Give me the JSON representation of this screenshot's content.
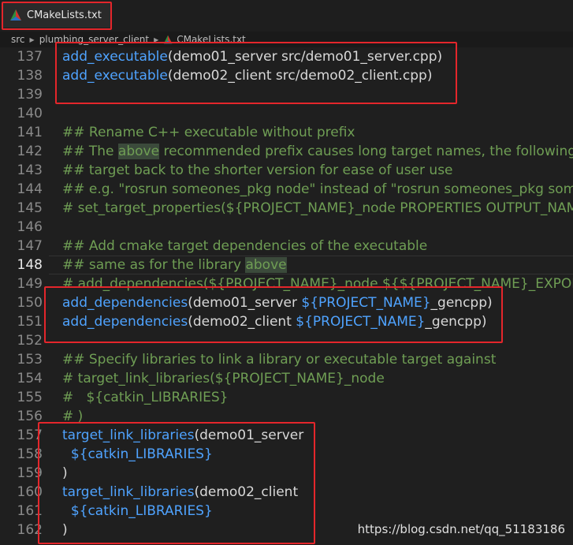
{
  "tab": {
    "label": "CMakeLists.txt"
  },
  "breadcrumb": [
    "src",
    "plumbing_server_client",
    "CMakeLists.txt"
  ],
  "current_line": "148",
  "lines": [
    {
      "no": "137",
      "parts": [
        {
          "c": "fn",
          "t": "add_executable"
        },
        {
          "c": "",
          "t": "(demo01_server src/demo01_server.cpp)"
        }
      ]
    },
    {
      "no": "138",
      "parts": [
        {
          "c": "fn",
          "t": "add_executable"
        },
        {
          "c": "",
          "t": "(demo02_client src/demo02_client.cpp)"
        }
      ]
    },
    {
      "no": "139",
      "parts": []
    },
    {
      "no": "140",
      "parts": []
    },
    {
      "no": "141",
      "parts": [
        {
          "c": "cm",
          "t": "## Rename C++ executable without prefix"
        }
      ]
    },
    {
      "no": "142",
      "parts": [
        {
          "c": "cm",
          "t": "## The "
        },
        {
          "c": "cm hl",
          "t": "above"
        },
        {
          "c": "cm",
          "t": " recommended prefix causes long target names, the following renames the"
        }
      ]
    },
    {
      "no": "143",
      "parts": [
        {
          "c": "cm",
          "t": "## target back to the shorter version for ease of user use"
        }
      ]
    },
    {
      "no": "144",
      "parts": [
        {
          "c": "cm",
          "t": "## e.g. \"rosrun someones_pkg node\" instead of \"rosrun someones_pkg someones_pkg_node\""
        }
      ]
    },
    {
      "no": "145",
      "parts": [
        {
          "c": "cm",
          "t": "# set_target_properties(${PROJECT_NAME}_node PROPERTIES OUTPUT_NAME node PREFIX \"\")"
        }
      ]
    },
    {
      "no": "146",
      "parts": []
    },
    {
      "no": "147",
      "parts": [
        {
          "c": "cm",
          "t": "## Add cmake target dependencies of the executable"
        }
      ]
    },
    {
      "no": "148",
      "parts": [
        {
          "c": "cm",
          "t": "## same as for the library "
        },
        {
          "c": "cm hl",
          "t": "above"
        }
      ]
    },
    {
      "no": "149",
      "parts": [
        {
          "c": "cm",
          "t": "# add_dependencies(${PROJECT_NAME}_node ${${PROJECT_NAME}_EXPORTED_TARGETS} ${catkin_EXPORTED_TARGETS})"
        }
      ]
    },
    {
      "no": "150",
      "parts": [
        {
          "c": "fn",
          "t": "add_dependencies"
        },
        {
          "c": "",
          "t": "(demo01_server "
        },
        {
          "c": "var",
          "t": "${PROJECT_NAME}"
        },
        {
          "c": "",
          "t": "_gencpp)"
        }
      ]
    },
    {
      "no": "151",
      "parts": [
        {
          "c": "fn",
          "t": "add_dependencies"
        },
        {
          "c": "",
          "t": "(demo02_client "
        },
        {
          "c": "var",
          "t": "${PROJECT_NAME}"
        },
        {
          "c": "",
          "t": "_gencpp)"
        }
      ]
    },
    {
      "no": "152",
      "parts": []
    },
    {
      "no": "153",
      "parts": [
        {
          "c": "cm",
          "t": "## Specify libraries to link a library or executable target against"
        }
      ]
    },
    {
      "no": "154",
      "parts": [
        {
          "c": "cm",
          "t": "# target_link_libraries(${PROJECT_NAME}_node"
        }
      ]
    },
    {
      "no": "155",
      "parts": [
        {
          "c": "cm",
          "t": "#   ${catkin_LIBRARIES}"
        }
      ]
    },
    {
      "no": "156",
      "parts": [
        {
          "c": "cm",
          "t": "# )"
        }
      ]
    },
    {
      "no": "157",
      "parts": [
        {
          "c": "fn",
          "t": "target_link_libraries"
        },
        {
          "c": "",
          "t": "(demo01_server"
        }
      ]
    },
    {
      "no": "158",
      "parts": [
        {
          "c": "",
          "t": "  "
        },
        {
          "c": "var",
          "t": "${catkin_LIBRARIES}"
        }
      ]
    },
    {
      "no": "159",
      "parts": [
        {
          "c": "",
          "t": ")"
        }
      ]
    },
    {
      "no": "160",
      "parts": [
        {
          "c": "fn",
          "t": "target_link_libraries"
        },
        {
          "c": "",
          "t": "(demo02_client"
        }
      ]
    },
    {
      "no": "161",
      "parts": [
        {
          "c": "",
          "t": "  "
        },
        {
          "c": "var",
          "t": "${catkin_LIBRARIES}"
        }
      ]
    },
    {
      "no": "162",
      "parts": [
        {
          "c": "",
          "t": ")"
        }
      ]
    }
  ],
  "watermark": "https://blog.csdn.net/qq_51183186",
  "colors": {
    "background": "#1f1f1f",
    "function": "#4fa3ff",
    "comment": "#6f9e54",
    "highlight_box": "#e4262b"
  }
}
